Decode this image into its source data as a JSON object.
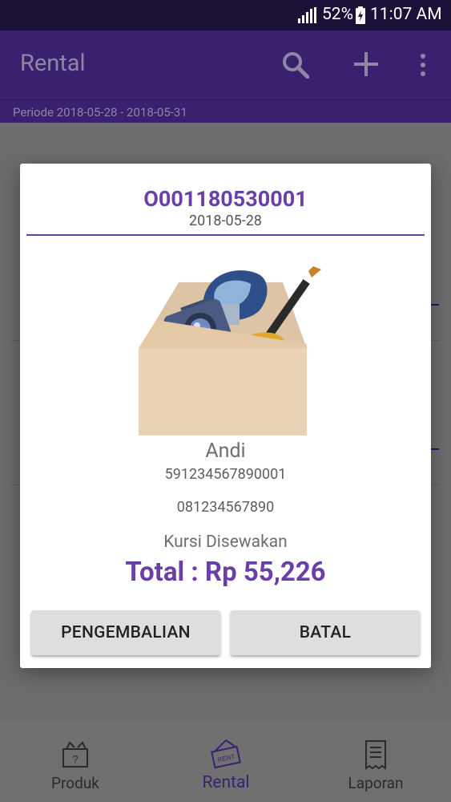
{
  "status": {
    "battery": "52%",
    "time": "11:07 AM",
    "icons": [
      "signal-icon",
      "battery-icon"
    ]
  },
  "appbar": {
    "title": "Rental",
    "icons": [
      "search-icon",
      "add-icon",
      "more-vert-icon"
    ]
  },
  "period": "Periode 2018-05-28 - 2018-05-31",
  "dialog": {
    "code": "O001180530001",
    "date": "2018-05-28",
    "image": "box-with-rental-items",
    "customer_name": "Andi",
    "id_number": "591234567890001",
    "phone": "081234567890",
    "item": "Kursi Disewakan",
    "total": "Total : Rp 55,226",
    "buttons": {
      "return": "PENGEMBALIAN",
      "cancel": "BATAL"
    }
  },
  "bottom_nav": [
    {
      "label": "Produk",
      "icon": "product-bag-icon",
      "active": false
    },
    {
      "label": "Rental",
      "icon": "rent-sign-icon",
      "active": true
    },
    {
      "label": "Laporan",
      "icon": "receipt-icon",
      "active": false
    }
  ],
  "colors": {
    "status_bar": "#1c0f38",
    "app_bar": "#3a2170",
    "accent": "#6a3fa8",
    "dim_background": "#6f6f6f"
  }
}
